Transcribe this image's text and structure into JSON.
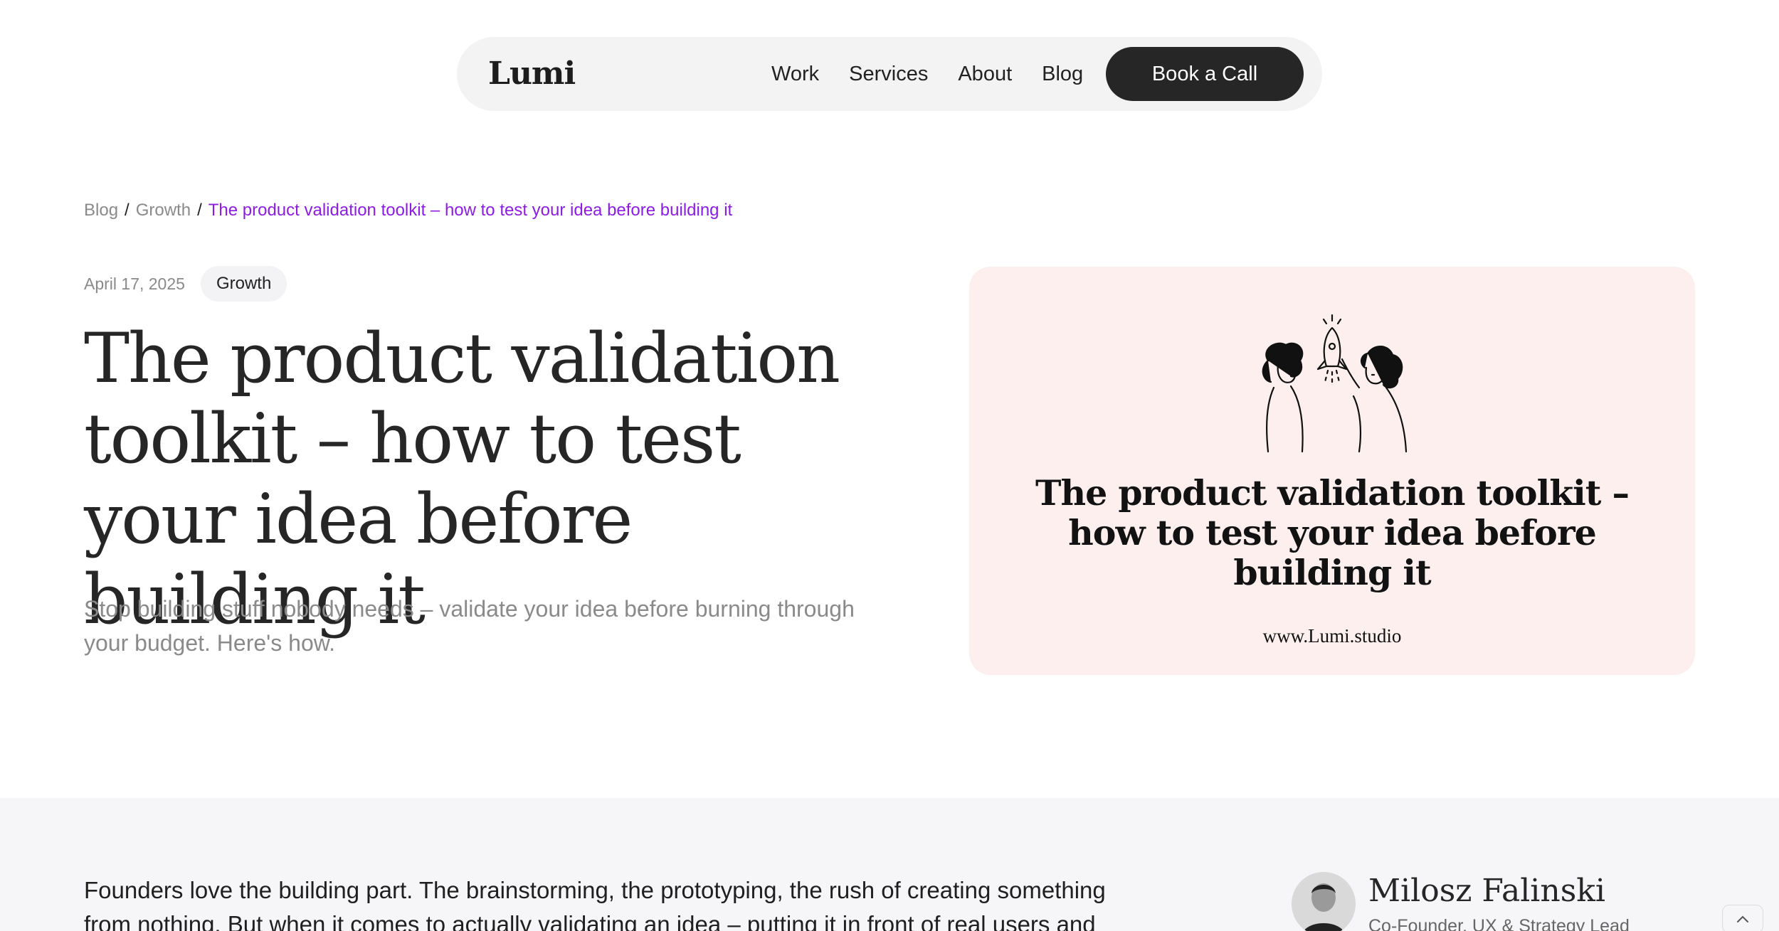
{
  "nav": {
    "logo": "Lumi",
    "links": [
      "Work",
      "Services",
      "About",
      "Blog"
    ],
    "cta": "Book a Call"
  },
  "breadcrumb": {
    "items": [
      "Blog",
      "Growth"
    ],
    "separator": "/",
    "current": "The product validation toolkit – how to test your idea before building it"
  },
  "article": {
    "date": "April 17, 2025",
    "tag": "Growth",
    "title": "The product validation toolkit – how to test your idea before building it",
    "subtitle": "Stop building stuff nobody needs – validate your idea before burning through your budget. Here's how."
  },
  "hero": {
    "title": "The product validation toolkit – how to test your idea before building it",
    "url": "www.Lumi.studio",
    "illustration_icon": "rocket-highfive-illustration"
  },
  "body": {
    "intro": "Founders love the building part. The brainstorming, the prototyping, the rush of creating something from nothing. But when it comes to actually validating an idea – putting it in front of real users and asking for"
  },
  "author": {
    "name": "Milosz Falinski",
    "role": "Co-Founder, UX & Strategy Lead"
  },
  "colors": {
    "accent_purple": "#8b1de0",
    "hero_bg": "#fcefed",
    "cta_bg": "#262626",
    "section_bg": "#f6f6f8"
  }
}
